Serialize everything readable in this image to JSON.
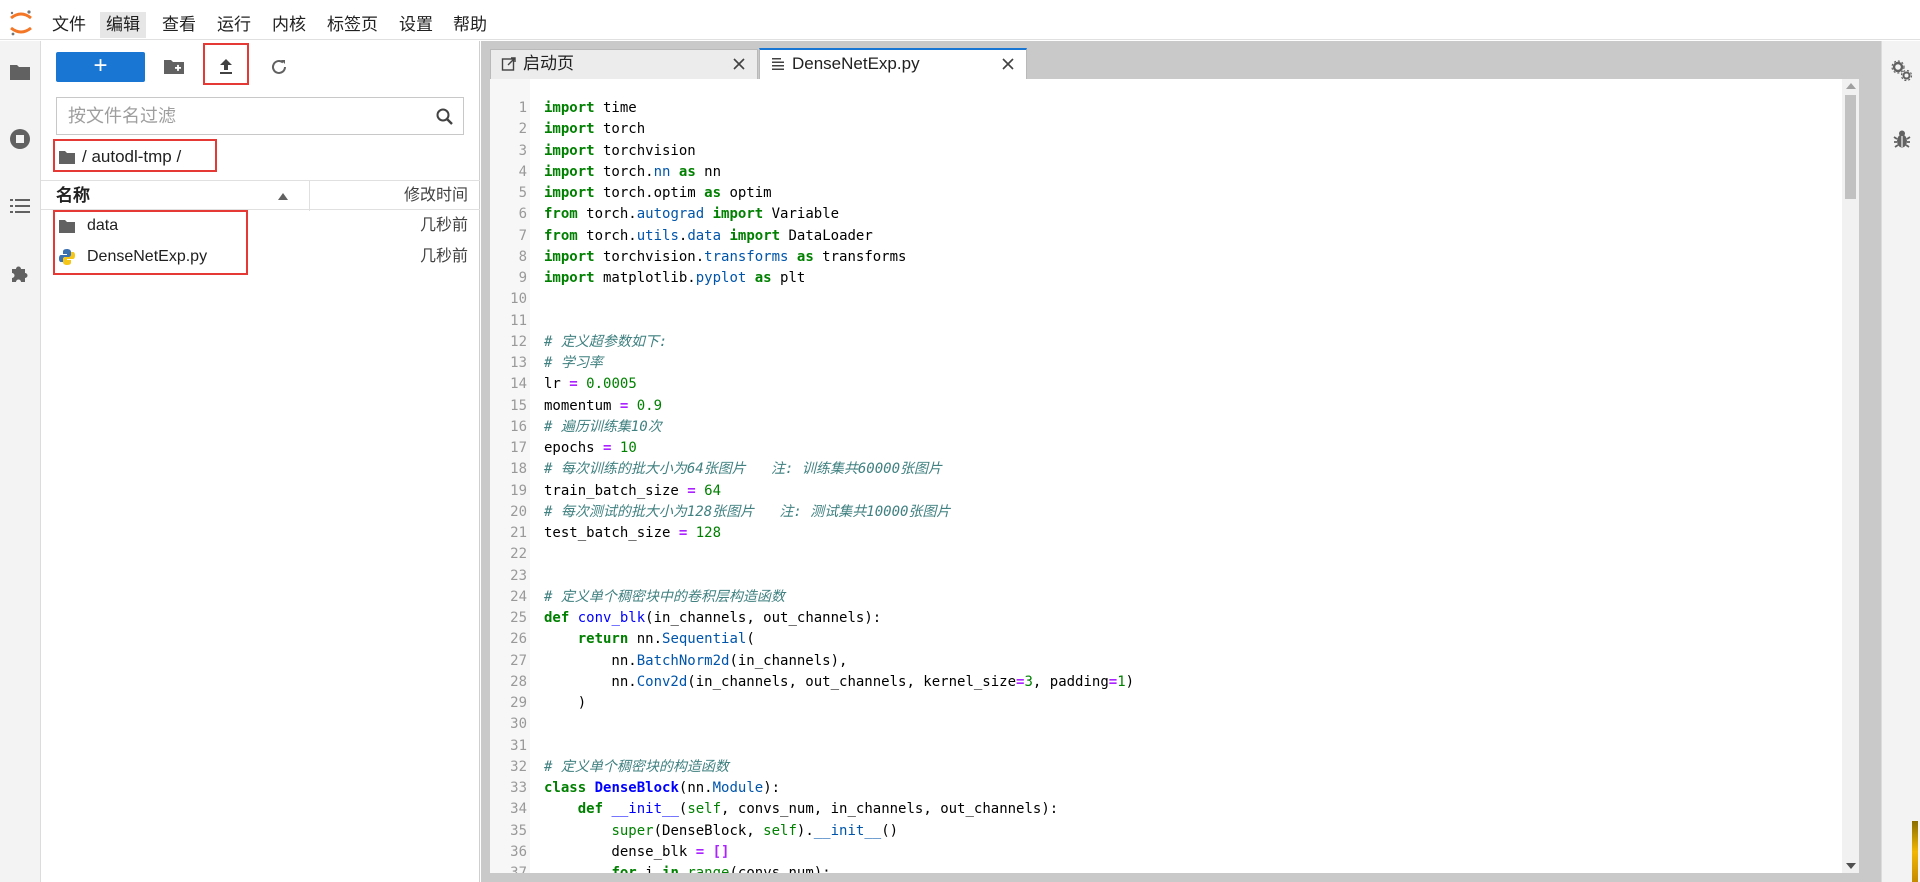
{
  "menu": {
    "items": [
      "文件",
      "编辑",
      "查看",
      "运行",
      "内核",
      "标签页",
      "设置",
      "帮助"
    ],
    "active_index": 1
  },
  "icons": {
    "logo": "jupyter-logo-icon",
    "left_sidebar": [
      "folder-icon",
      "stop-circle-icon",
      "list-icon",
      "puzzle-icon"
    ],
    "right_sidebar": [
      "gears-icon",
      "bug-icon"
    ],
    "toolbar": [
      "plus-icon",
      "new-folder-icon",
      "upload-icon",
      "refresh-icon"
    ]
  },
  "file_browser": {
    "new_label": "+",
    "filter_placeholder": "按文件名过滤",
    "filter_value": "",
    "breadcrumb": "/ autodl-tmp /",
    "columns": {
      "name": "名称",
      "modified": "修改时间"
    },
    "files": [
      {
        "name": "data",
        "modified": "几秒前",
        "type": "folder"
      },
      {
        "name": "DenseNetExp.py",
        "modified": "几秒前",
        "type": "python"
      }
    ]
  },
  "tabs": [
    {
      "label": "启动页",
      "icon": "launcher-icon",
      "active": false
    },
    {
      "label": "DenseNetExp.py",
      "icon": "text-file-icon",
      "active": true
    }
  ],
  "editor": {
    "lines": [
      "import time",
      "import torch",
      "import torchvision",
      "import torch.nn as nn",
      "import torch.optim as optim",
      "from torch.autograd import Variable",
      "from torch.utils.data import DataLoader",
      "import torchvision.transforms as transforms",
      "import matplotlib.pyplot as plt",
      "",
      "",
      "# 定义超参数如下:",
      "# 学习率",
      "lr = 0.0005",
      "momentum = 0.9",
      "# 遍历训练集10次",
      "epochs = 10",
      "# 每次训练的批大小为64张图片   注: 训练集共60000张图片",
      "train_batch_size = 64",
      "# 每次测试的批大小为128张图片   注: 测试集共10000张图片",
      "test_batch_size = 128",
      "",
      "",
      "# 定义单个稠密块中的卷积层构造函数",
      "def conv_blk(in_channels, out_channels):",
      "    return nn.Sequential(",
      "        nn.BatchNorm2d(in_channels),",
      "        nn.Conv2d(in_channels, out_channels, kernel_size=3, padding=1)",
      "    )",
      "",
      "",
      "# 定义单个稠密块的构造函数",
      "class DenseBlock(nn.Module):",
      "    def __init__(self, convs_num, in_channels, out_channels):",
      "        super(DenseBlock, self).__init__()",
      "        dense_blk = []",
      "        for i in range(convs_num):"
    ]
  },
  "colors": {
    "accent": "#1976d2",
    "highlight_box": "#e53935",
    "keyword": "#008000",
    "comment": "#408080"
  }
}
